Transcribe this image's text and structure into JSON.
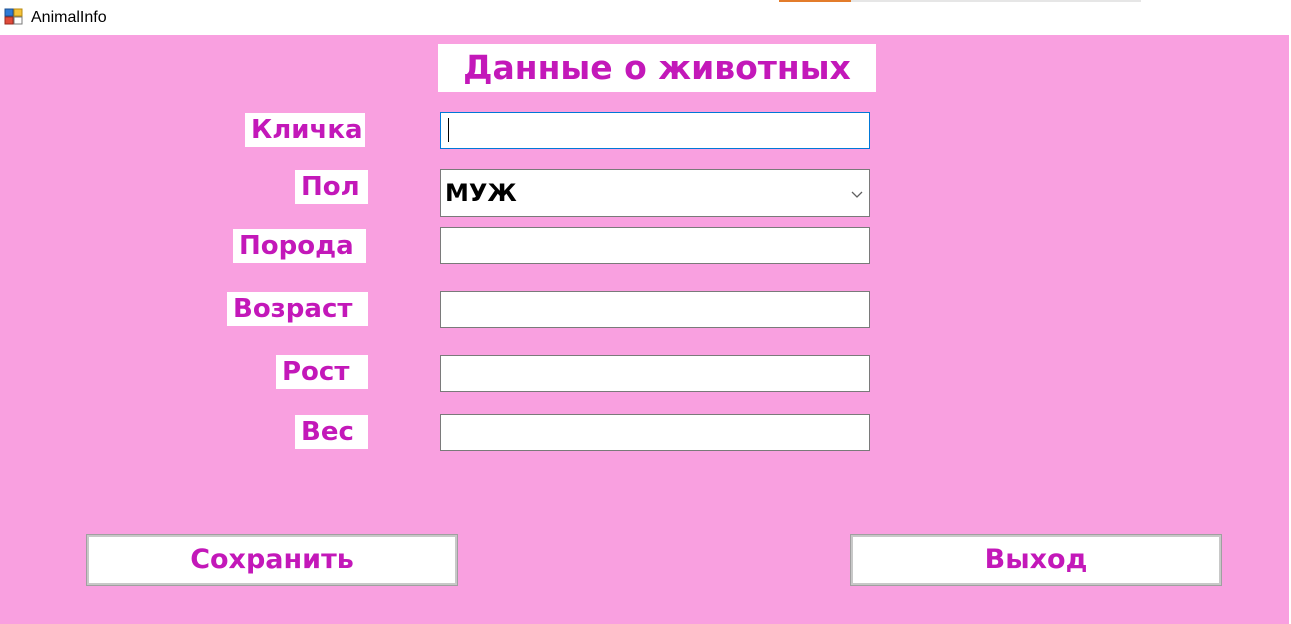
{
  "window": {
    "title": "AnimalInfo",
    "icon": "form-app-icon"
  },
  "form": {
    "heading": "Данные о животных",
    "fields": {
      "name": {
        "label": "Кличка",
        "value": ""
      },
      "sex": {
        "label": "Пол",
        "selected": "МУЖ"
      },
      "breed": {
        "label": "Порода",
        "value": ""
      },
      "age": {
        "label": "Возраст",
        "value": ""
      },
      "height": {
        "label": "Рост",
        "value": ""
      },
      "weight": {
        "label": "Вес",
        "value": ""
      }
    },
    "buttons": {
      "save": "Сохранить",
      "exit": "Выход"
    }
  },
  "colors": {
    "background": "#f9a0e0",
    "label_text": "#c318b9",
    "focus_border": "#0078d7"
  }
}
